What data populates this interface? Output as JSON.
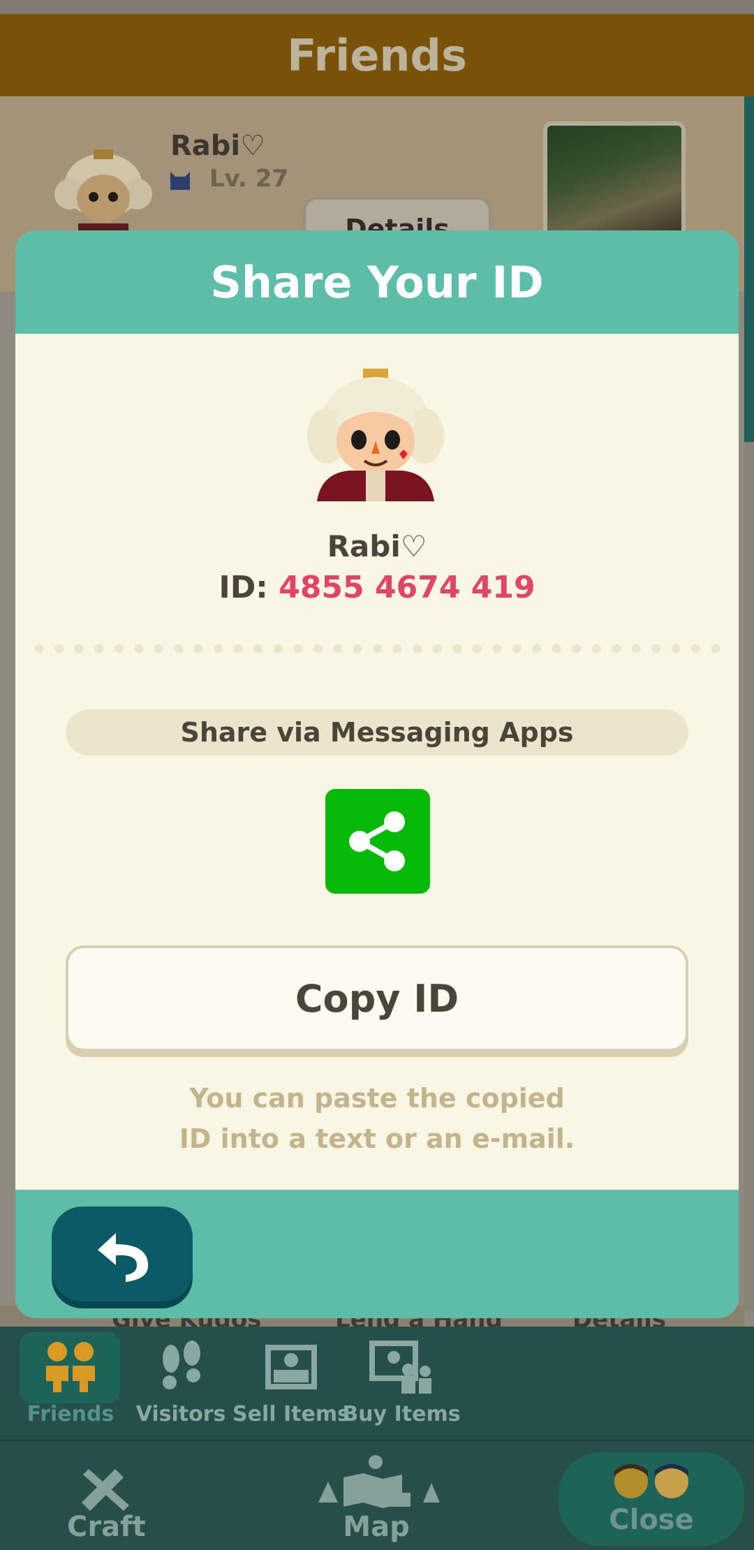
{
  "background": {
    "title": "Friends",
    "friend": {
      "name": "Rabi♡",
      "level": "Lv. 27",
      "details_label": "Details"
    },
    "lower_actions": [
      "Give Kudos",
      "Lend a Hand",
      "Details"
    ]
  },
  "modal": {
    "title": "Share Your ID",
    "player_name": "Rabi♡",
    "id_label": "ID:",
    "id_value": "4855 4674 419",
    "share_label": "Share via Messaging Apps",
    "copy_label": "Copy ID",
    "hint_line1": "You can paste the copied",
    "hint_line2": "ID into a text or an e-mail."
  },
  "nav": {
    "row1": [
      {
        "label": "Friends",
        "icon": "friends-icon",
        "active": true
      },
      {
        "label": "Visitors",
        "icon": "footprints-icon"
      },
      {
        "label": "Sell Items",
        "icon": "sell-box-icon"
      },
      {
        "label": "Buy Items",
        "icon": "buy-box-icon"
      }
    ],
    "row2": [
      {
        "label": "Craft",
        "icon": "hammer-saw-icon"
      },
      {
        "label": "Map",
        "icon": "map-icon"
      },
      {
        "label": "Close",
        "icon": "villagers-icon"
      }
    ]
  },
  "colors": {
    "header_teal": "#5cbda8",
    "id_pink": "#e04467",
    "share_green": "#06b906",
    "back_button": "#0d5a67",
    "title_bar": "#7a5209"
  }
}
